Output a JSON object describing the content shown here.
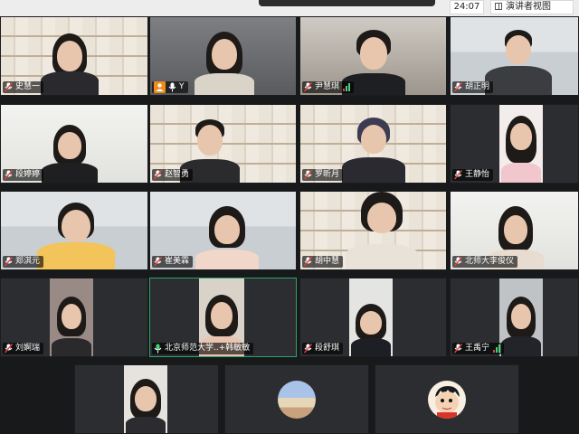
{
  "topbar": {
    "timer": "24:07",
    "view_button_label": "演讲者视图"
  },
  "participants": [
    {
      "name": "史慧一",
      "mic": "muted",
      "speaking": false
    },
    {
      "name": "Y",
      "mic": "on",
      "speaking": false,
      "badge": "orange"
    },
    {
      "name": "尹慧琪",
      "mic": "muted",
      "speaking": true
    },
    {
      "name": "胡正明",
      "mic": "muted",
      "speaking": false
    },
    {
      "name": "段婷婷",
      "mic": "muted",
      "speaking": false
    },
    {
      "name": "赵智勇",
      "mic": "muted",
      "speaking": false
    },
    {
      "name": "罗昕月",
      "mic": "muted",
      "speaking": false
    },
    {
      "name": "王静怡",
      "mic": "muted",
      "speaking": false
    },
    {
      "name": "郑淇元",
      "mic": "muted",
      "speaking": false
    },
    {
      "name": "崔美霖",
      "mic": "muted",
      "speaking": false
    },
    {
      "name": "胡中慧",
      "mic": "muted",
      "speaking": false
    },
    {
      "name": "北师大李俊仪",
      "mic": "muted",
      "speaking": false
    },
    {
      "name": "刘婀瑞",
      "mic": "muted",
      "speaking": false
    },
    {
      "name": "北京师范大学..+韩敏敏",
      "mic": "on",
      "speaking": false,
      "active": true
    },
    {
      "name": "段舒琪",
      "mic": "muted",
      "speaking": false
    },
    {
      "name": "王禹宁",
      "mic": "muted",
      "speaking": true
    },
    {
      "name": "",
      "mic": "none",
      "speaking": false
    },
    {
      "name": "",
      "mic": "none",
      "speaking": false,
      "avatar": "landscape"
    },
    {
      "name": "",
      "mic": "none",
      "speaking": false,
      "avatar": "cartoon"
    }
  ],
  "colors": {
    "active_border": "#2fa36a",
    "speaking_bars": "#4bd07a",
    "muted_mic": "#e0413a",
    "badge_orange": "#f08a1b"
  }
}
